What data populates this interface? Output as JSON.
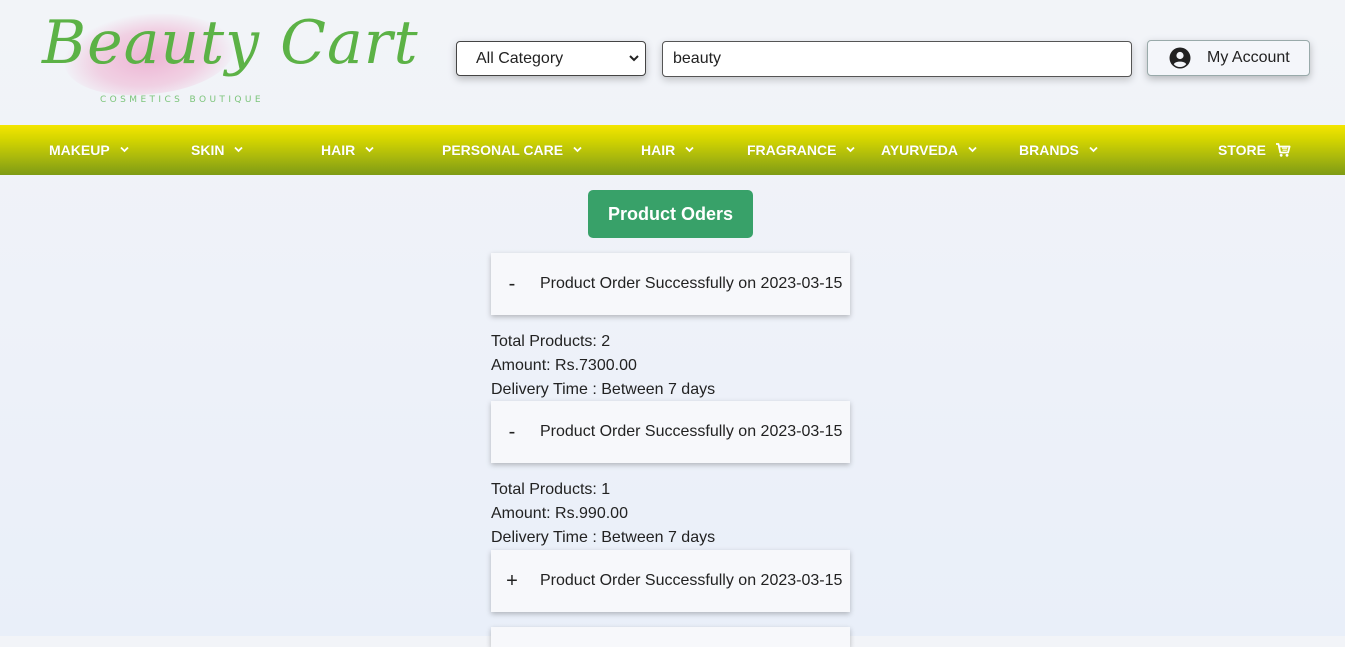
{
  "brand": {
    "name": "Beauty Cart",
    "tagline": "COSMETICS BOUTIQUE",
    "brand_color": "#5cb246"
  },
  "search": {
    "category_selected": "All Category",
    "query": "beauty"
  },
  "account": {
    "label": "My Account",
    "icon": "user-circle-icon"
  },
  "nav": {
    "items": [
      {
        "label": "MAKEUP"
      },
      {
        "label": "SKIN"
      },
      {
        "label": "HAIR"
      },
      {
        "label": "PERSONAL CARE"
      },
      {
        "label": "HAIR"
      },
      {
        "label": "FRAGRANCE"
      },
      {
        "label": "AYURVEDA"
      },
      {
        "label": "BRANDS"
      }
    ],
    "store_label": "STORE",
    "store_icon": "cart-icon"
  },
  "orders": {
    "heading": "Product Oders",
    "accent_color": "#38a169",
    "list": [
      {
        "toggle": "-",
        "title": "Product Order Successfully on 2023-03-15",
        "total_products": "Total Products: 2",
        "amount": "Amount: Rs.7300.00",
        "delivery": "Delivery Time : Between 7 days"
      },
      {
        "toggle": "-",
        "title": "Product Order Successfully on 2023-03-15",
        "total_products": "Total Products: 1",
        "amount": "Amount: Rs.990.00",
        "delivery": "Delivery Time : Between 7 days"
      },
      {
        "toggle": "+",
        "title": "Product Order Successfully on 2023-03-15"
      }
    ]
  }
}
